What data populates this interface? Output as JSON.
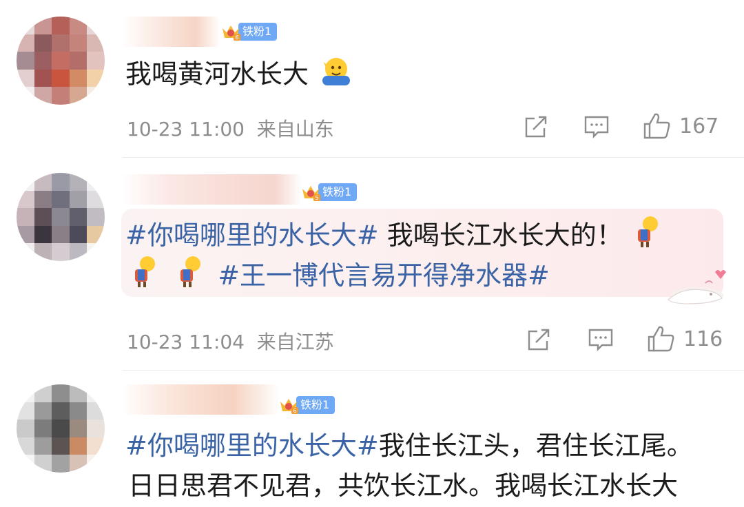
{
  "comments": [
    {
      "badge": "铁粉1",
      "text": "我喝黄河水长大",
      "time": "10-23 11:00",
      "location": "来自山东",
      "likes": "167"
    },
    {
      "badge": "铁粉1",
      "topic1": "#你喝哪里的水长大#",
      "text1": " 我喝长江水长大的！",
      "topic2": "#王一博代言易开得净水器#",
      "time": "10-23 11:04",
      "location": "来自江苏",
      "likes": "116"
    },
    {
      "badge": "铁粉1",
      "topic": "#你喝哪里的水长大#",
      "text1": "我住长江头，君住长江尾。",
      "text2": "日日思君不见君，共饮长江水。我喝长江水长大"
    }
  ],
  "icons": {
    "share": "share-icon",
    "comment": "comment-icon",
    "like": "thumbs-up-icon",
    "crown": "crown-badge-icon"
  },
  "colors": {
    "topic": "#3a63a6",
    "meta": "#8d8d8d",
    "badge": "#6fa8f5"
  }
}
